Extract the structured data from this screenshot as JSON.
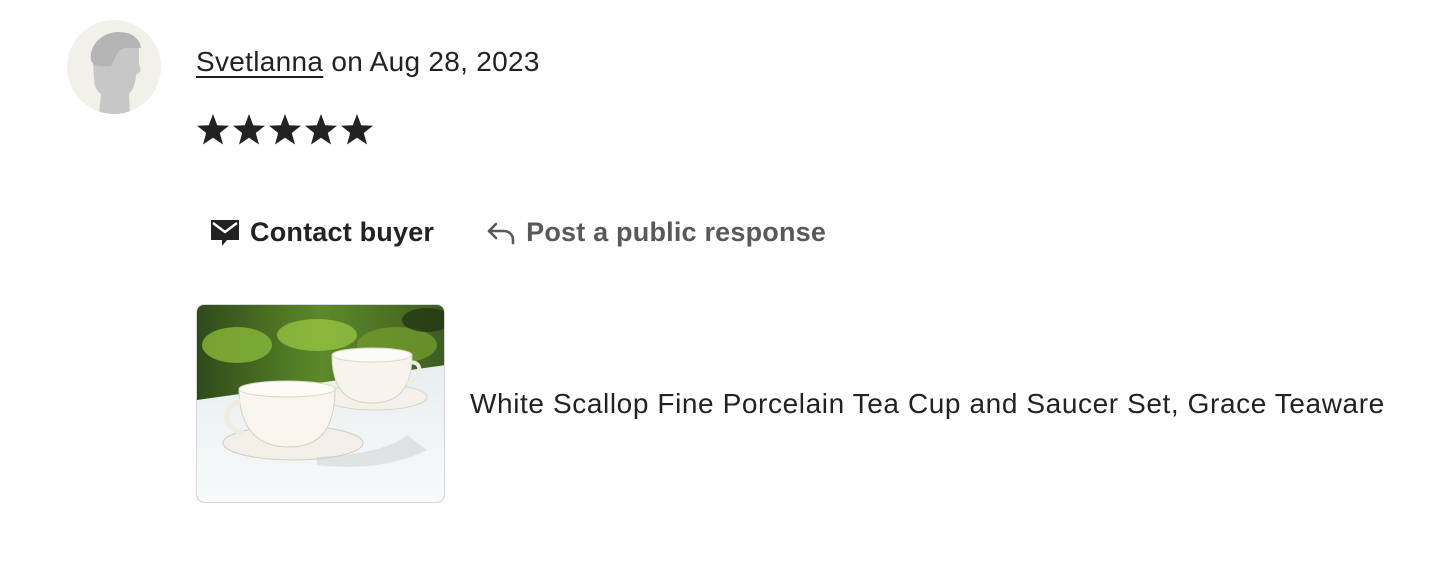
{
  "review": {
    "reviewer_name": "Svetlanna",
    "date_text": " on Aug 28, 2023",
    "rating": 5,
    "rating_max": 5
  },
  "actions": {
    "contact_buyer_label": "Contact buyer",
    "contact_icon": "mail-icon",
    "public_response_label": "Post a public response",
    "public_response_icon": "reply-arrow-icon"
  },
  "listing": {
    "title": "White Scallop Fine Porcelain Tea Cup and Saucer Set, Grace Teaware"
  },
  "colors": {
    "text_primary": "#222222",
    "text_secondary": "#595959",
    "avatar_bg": "#f1f1ea",
    "avatar_silhouette": "#c7c7c7"
  }
}
